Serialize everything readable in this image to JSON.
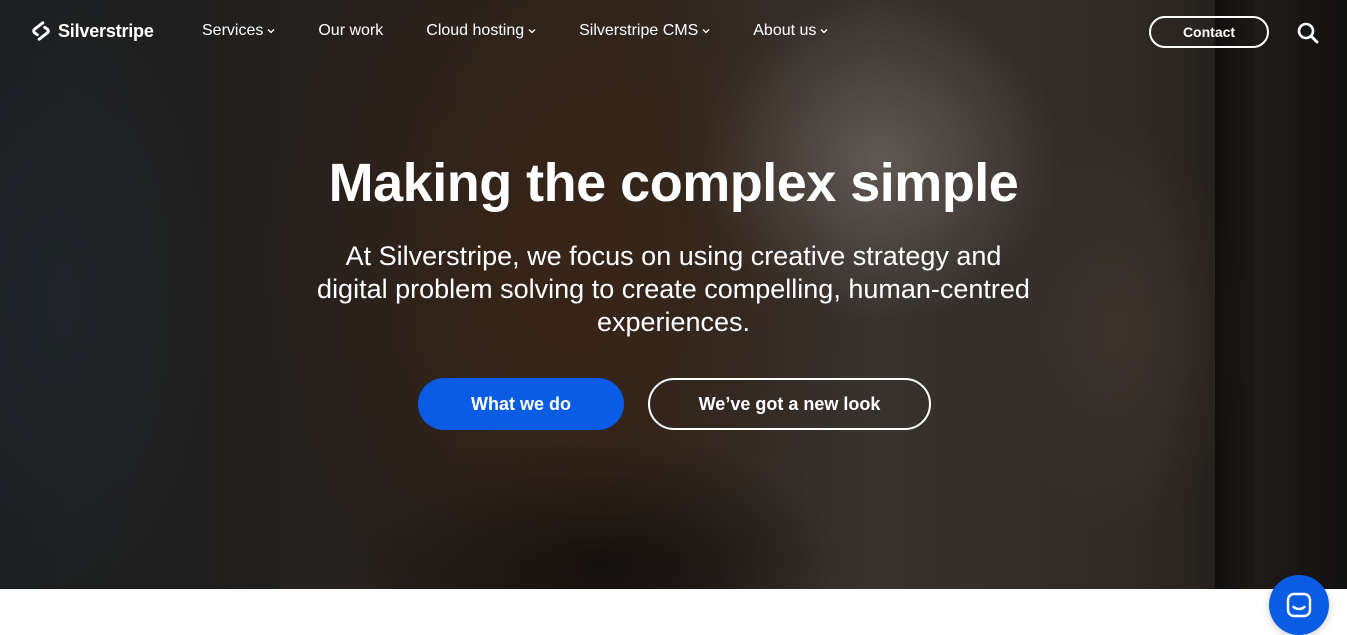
{
  "brand": {
    "name": "Silverstripe"
  },
  "nav": {
    "items": [
      {
        "label": "Services",
        "has_dropdown": true
      },
      {
        "label": "Our work",
        "has_dropdown": false
      },
      {
        "label": "Cloud hosting",
        "has_dropdown": true
      },
      {
        "label": "Silverstripe CMS",
        "has_dropdown": true
      },
      {
        "label": "About us",
        "has_dropdown": true
      }
    ],
    "contact_label": "Contact",
    "search_icon": "search-icon"
  },
  "hero": {
    "title": "Making the complex simple",
    "subtitle": "At Silverstripe, we focus on using creative strategy and digital problem solving to create compelling, human-centred experiences.",
    "primary_cta": "What we do",
    "secondary_cta": "We’ve got a new look"
  },
  "chat": {
    "icon": "chat-icon"
  },
  "colors": {
    "accent": "#0a5ce5",
    "text_on_dark": "#ffffff",
    "page_bg": "#ffffff"
  }
}
